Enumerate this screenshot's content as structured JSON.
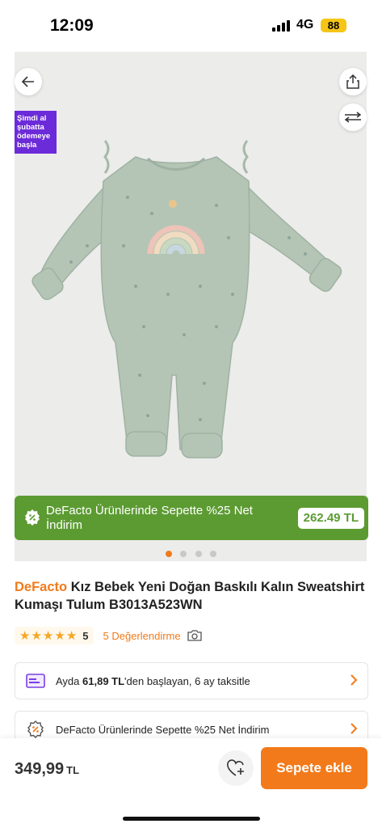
{
  "status_bar": {
    "time": "12:09",
    "network": "4G",
    "battery": "88"
  },
  "image": {
    "promo_sticker": [
      "Şimdi al",
      "şubatta",
      "ödemeye",
      "başla"
    ],
    "discount_banner": {
      "text": "DeFacto Ürünlerinde Sepette %25 Net İndirim",
      "price": "262.49 TL",
      "color": "#5c9b32"
    },
    "carousel": {
      "total": 4,
      "active": 1
    },
    "icons": {
      "back": "arrow-left-icon",
      "share": "share-icon",
      "compare": "compare-arrows-icon"
    }
  },
  "product": {
    "brand": "DeFacto",
    "name": "Kız Bebek Yeni Doğan Baskılı Kalın Sweatshirt Kumaşı Tulum B3013A523WN",
    "rating": "5",
    "rating_stars": 5,
    "reviews_label": "5 Değerlendirme"
  },
  "cards": {
    "installment": {
      "prefix": "Ayda ",
      "amount": "61,89 TL",
      "suffix": "'den başlayan, 6 ay taksitle"
    },
    "discount": {
      "text": "DeFacto Ürünlerinde Sepette %25 Net İndirim"
    }
  },
  "bottom_bar": {
    "price": "349,99",
    "currency": "TL",
    "add_to_cart": "Sepete ekle"
  },
  "colors": {
    "accent": "#f27a1a",
    "promo": "#6c2bd9",
    "discount_green": "#5c9b32"
  }
}
